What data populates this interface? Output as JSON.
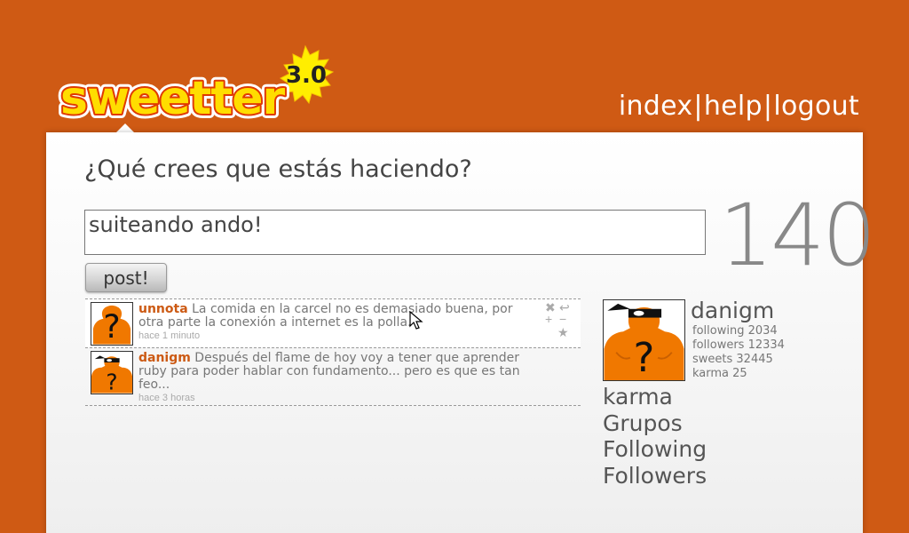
{
  "header": {
    "logo_text": "sweetter",
    "logo_version": "3.0",
    "nav": [
      {
        "label": "index"
      },
      {
        "label": "help"
      },
      {
        "label": "logout"
      }
    ],
    "nav_separator": "|"
  },
  "composer": {
    "question": "¿Qué crees que estás haciendo?",
    "input_value": "suiteando ando!",
    "char_counter": "140",
    "post_label": "post!"
  },
  "timeline": [
    {
      "user": "unnota",
      "text": " La comida en la carcel no es demasiado buena, por otra parte la conexión a internet es la polla.",
      "time": "hace 1 minuto",
      "avatar": "question-mark-avatar"
    },
    {
      "user": "danigm",
      "text": " Después del flame de hoy voy a tener que aprender ruby para poder hablar con fundamento... pero es que es tan feo...",
      "time": "hace 3 horas",
      "avatar": "masked-figure-avatar"
    }
  ],
  "tweet_actions": {
    "icons": [
      "reply-icon",
      "add-icon",
      "remove-icon",
      "favorite-star-icon"
    ],
    "glyphs": [
      "✖",
      "↩",
      "+",
      "−",
      "★"
    ]
  },
  "profile": {
    "username": "danigm",
    "stats": [
      "following 2034",
      "followers 12334",
      "sweets 32445",
      "karma 25"
    ],
    "links": [
      "karma",
      "Grupos",
      "Following",
      "Followers"
    ]
  },
  "colors": {
    "background": "#cf5a14",
    "accent": "#cc5a14",
    "logo_yellow": "#ffe000",
    "avatar_orange": "#f07800"
  }
}
